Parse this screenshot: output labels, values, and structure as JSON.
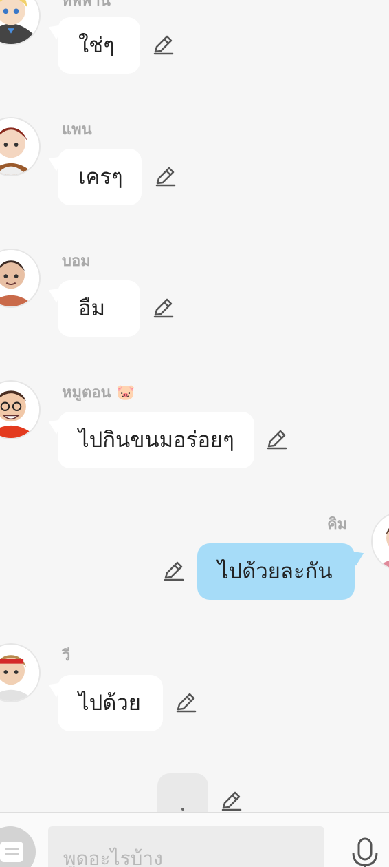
{
  "messages": [
    {
      "sender": "ทิพพานี",
      "text": "ใช่ๆ",
      "mine": false
    },
    {
      "sender": "แพน",
      "text": "เครๆ",
      "mine": false
    },
    {
      "sender": "บอม",
      "text": "อืม",
      "mine": false
    },
    {
      "sender": "หมูตอน 🐷",
      "text": "ไปกินขนมอร่อยๆ",
      "mine": false
    },
    {
      "sender": "คิม",
      "text": "ไปด้วยละกัน",
      "mine": true
    },
    {
      "sender": "วี",
      "text": "ไปด้วย",
      "mine": false
    }
  ],
  "typing_indicator": {
    "text": "."
  },
  "composer": {
    "placeholder": "พูดอะไรบ้าง"
  },
  "icons": {
    "edit": "pencil-icon",
    "menu": "menu-icon",
    "mic": "microphone-icon"
  },
  "colors": {
    "background": "#f6f6f6",
    "bubble_other": "#ffffff",
    "bubble_mine": "#a6dcf8",
    "name_text": "#a9a9a9"
  }
}
